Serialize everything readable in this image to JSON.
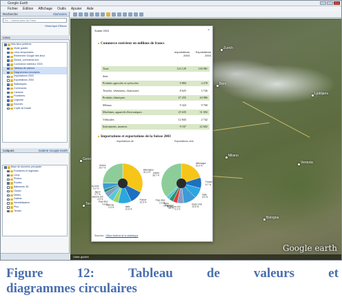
{
  "window": {
    "title": "Google Earth",
    "menu": [
      "Fichier",
      "Édition",
      "Affichage",
      "Outils",
      "Ajouter",
      "Aide"
    ]
  },
  "sidebar": {
    "search_head": "Recherche",
    "search_link": "Itinéraires",
    "search_placeholder": "Ex. : Hôtels près de Paris",
    "search_links": "Historique   Effacer",
    "places_head": "Lieux",
    "places_items": [
      {
        "label": "Mes lieux préférés",
        "checked": true,
        "selected": false
      },
      {
        "label": "Visite guidée",
        "checked": true,
        "selected": false
      },
      {
        "label": "Lieux temporaires",
        "checked": true,
        "selected": false
      },
      {
        "label": "Recherche Google des lieux",
        "checked": true,
        "selected": false
      },
      {
        "label": "Suisse_commerce.kml",
        "checked": true,
        "selected": false
      },
      {
        "label": "Commerce extérieur 2003",
        "checked": true,
        "selected": false
      },
      {
        "label": "Tableau de valeurs",
        "checked": true,
        "selected": true
      },
      {
        "label": "Diagrammes circulaires",
        "checked": true,
        "selected": true
      },
      {
        "label": "Importations 2003",
        "checked": false,
        "selected": false
      },
      {
        "label": "Exportations 2003",
        "checked": false,
        "selected": false
      },
      {
        "label": "Statistiques",
        "checked": true,
        "selected": false
      },
      {
        "label": "Communes",
        "checked": true,
        "selected": false
      },
      {
        "label": "Cantons",
        "checked": true,
        "selected": false
      },
      {
        "label": "Frontières",
        "checked": true,
        "selected": false
      },
      {
        "label": "Légende",
        "checked": true,
        "selected": false
      },
      {
        "label": "Sources",
        "checked": true,
        "selected": false
      },
      {
        "label": "Copie de travail",
        "checked": false,
        "selected": false
      }
    ],
    "layers_head": "Calques",
    "layers_link": "Galerie Google Earth",
    "layers_items": [
      {
        "label": "Base de données principale",
        "checked": true
      },
      {
        "label": "Frontières et légendes",
        "checked": true
      },
      {
        "label": "Lieux",
        "checked": true
      },
      {
        "label": "Photos",
        "checked": false
      },
      {
        "label": "Routes",
        "checked": true
      },
      {
        "label": "Bâtiments 3D",
        "checked": false
      },
      {
        "label": "Océan",
        "checked": false
      },
      {
        "label": "Météo",
        "checked": false
      },
      {
        "label": "Galerie",
        "checked": false
      },
      {
        "label": "Sensibilisation",
        "checked": false
      },
      {
        "label": "Plus",
        "checked": false
      },
      {
        "label": "Terrain",
        "checked": true
      }
    ]
  },
  "map": {
    "places": [
      "Zurich",
      "Bern",
      "Genève",
      "Milano",
      "Torino",
      "Venezia",
      "Ljubljana",
      "Bologna"
    ],
    "logo": "Google earth",
    "footer": "Visite guidée"
  },
  "balloon": {
    "title": "Suisse 2003",
    "section1_title": "Commerce extérieur en millions de francs",
    "col_headers": [
      "Importations 2003",
      "Exportations 2003"
    ],
    "rows": [
      {
        "label": "Total",
        "imp": "123 129",
        "exp": "130 981",
        "shade": true
      },
      {
        "label": "dont",
        "imp": "",
        "exp": "",
        "shade": false
      },
      {
        "label": "Produits agricoles et sylvicoles",
        "imp": "9 884",
        "exp": "4 278",
        "shade": true
      },
      {
        "label": "Textiles, vêtements, chaussures",
        "imp": "8 625",
        "exp": "3 726",
        "shade": false
      },
      {
        "label": "Produits chimiques",
        "imp": "27 255",
        "exp": "44 986",
        "shade": true
      },
      {
        "label": "Métaux",
        "imp": "9 324",
        "exp": "9 760",
        "shade": false
      },
      {
        "label": "Machines, appareils électroniques",
        "imp": "25 635",
        "exp": "31 692",
        "shade": true
      },
      {
        "label": "Véhicules",
        "imp": "12 843",
        "exp": "2 742",
        "shade": false
      },
      {
        "label": "Instruments, montres",
        "imp": "9 167",
        "exp": "22 602",
        "shade": true
      }
    ],
    "section2_title": "Importations et exportations de la Suisse 2003",
    "pie_left_title": "Importations de",
    "pie_right_title": "Exportations vers",
    "source_label": "Sources :",
    "source_link": "Office fédéral de la statistique"
  },
  "chart_data": [
    {
      "type": "pie",
      "title": "Importations de",
      "categories": [
        "Allemagne",
        "France",
        "Italie",
        "Autriche",
        "Pays-Bas",
        "Royaume-Uni",
        "Japon",
        "Etats-Unis",
        "Autres"
      ],
      "values": [
        32.4,
        10.5,
        10.8,
        4.4,
        4.8,
        4.5,
        2.7,
        5.2,
        24.7
      ],
      "colors": [
        "#f5c518",
        "#1f6fc0",
        "#2aa7e0",
        "#9fd36b",
        "#58c7d6",
        "#7fa0c8",
        "#2f8f6f",
        "#3e9ad6",
        "#8ccd9a"
      ]
    },
    {
      "type": "pie",
      "title": "Exportations vers",
      "categories": [
        "Allemagne",
        "France",
        "Italie",
        "Etats-Unis",
        "Royaume-Uni",
        "Espagne",
        "Japon",
        "Pays-Bas",
        "Autres"
      ],
      "values": [
        20.3,
        8.7,
        8.5,
        10.6,
        5.2,
        3.6,
        3.5,
        2.9,
        36.7
      ],
      "colors": [
        "#f5c518",
        "#1f6fc0",
        "#2aa7e0",
        "#3e9ad6",
        "#7fa0c8",
        "#e23b3b",
        "#2f8f6f",
        "#58c7d6",
        "#8ccd9a"
      ]
    }
  ],
  "caption": {
    "line1_words": [
      "Figure",
      "12:",
      "Tableau",
      "de",
      "valeurs",
      "et"
    ],
    "line2": "diagrammes circulaires"
  }
}
